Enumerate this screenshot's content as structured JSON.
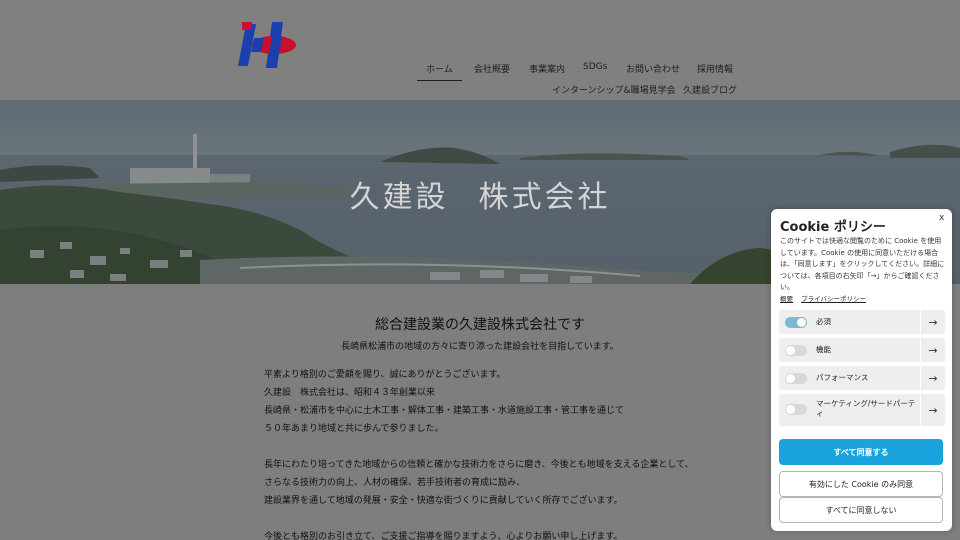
{
  "nav": {
    "items": [
      "ホーム",
      "会社概要",
      "事業案内",
      "SDGs",
      "お問い合わせ",
      "採用情報",
      "インターンシップ&職場見学会",
      "久建設ブログ"
    ]
  },
  "hero": {
    "title_part1": "久建設",
    "title_part2": "株式会社"
  },
  "content": {
    "title": "総合建設業の久建設株式会社です",
    "subtitle": "長崎県松浦市の地域の方々に寄り添った建設会社を目指しています。",
    "paragraphs": [
      "平素より格別のご愛顧を賜り、誠にありがとうございます。",
      "久建設　株式会社は、昭和４３年創業以来",
      "長崎県・松浦市を中心に土木工事・解体工事・建築工事・水道施設工事・管工事を通じて",
      "５０年あまり地域と共に歩んで参りました。",
      "長年にわたり培ってきた地域からの信頼と確かな技術力をさらに磨き、今後とも地域を支える企業として、",
      "さらなる技術力の向上、人材の確保、若手技術者の育成に励み、",
      "建設業界を通して地域の発展・安全・快適な街づくりに貢献していく所存でございます。",
      "今後とも格別のお引き立て、ご支援ご指導を賜りますよう、心よりお願い申し上げます。"
    ]
  },
  "cookie": {
    "title": "Cookie ポリシー",
    "close": "x",
    "description": "このサイトでは快適な閲覧のために Cookie を使用しています。Cookie の使用に同意いただける場合は、「同意します」をクリックしてください。詳細については、各項目の右矢印「→」からご確認ください。",
    "link_overview": "概要",
    "link_privacy": "プライバシーポリシー",
    "categories": [
      {
        "label": "必須",
        "enabled": true
      },
      {
        "label": "機能",
        "enabled": false
      },
      {
        "label": "パフォーマンス",
        "enabled": false
      },
      {
        "label": "マーケティング/サードパーティ",
        "enabled": false
      }
    ],
    "arrow": "→",
    "accept_all": "すべて同意する",
    "accept_enabled": "有効にした Cookie のみ同意",
    "reject_all": "すべてに同意しない"
  },
  "colors": {
    "logo_red": "#c8102e",
    "logo_blue": "#1b3fae",
    "accept_blue": "#1aa3df",
    "toggle_on": "#7ab8d8"
  }
}
